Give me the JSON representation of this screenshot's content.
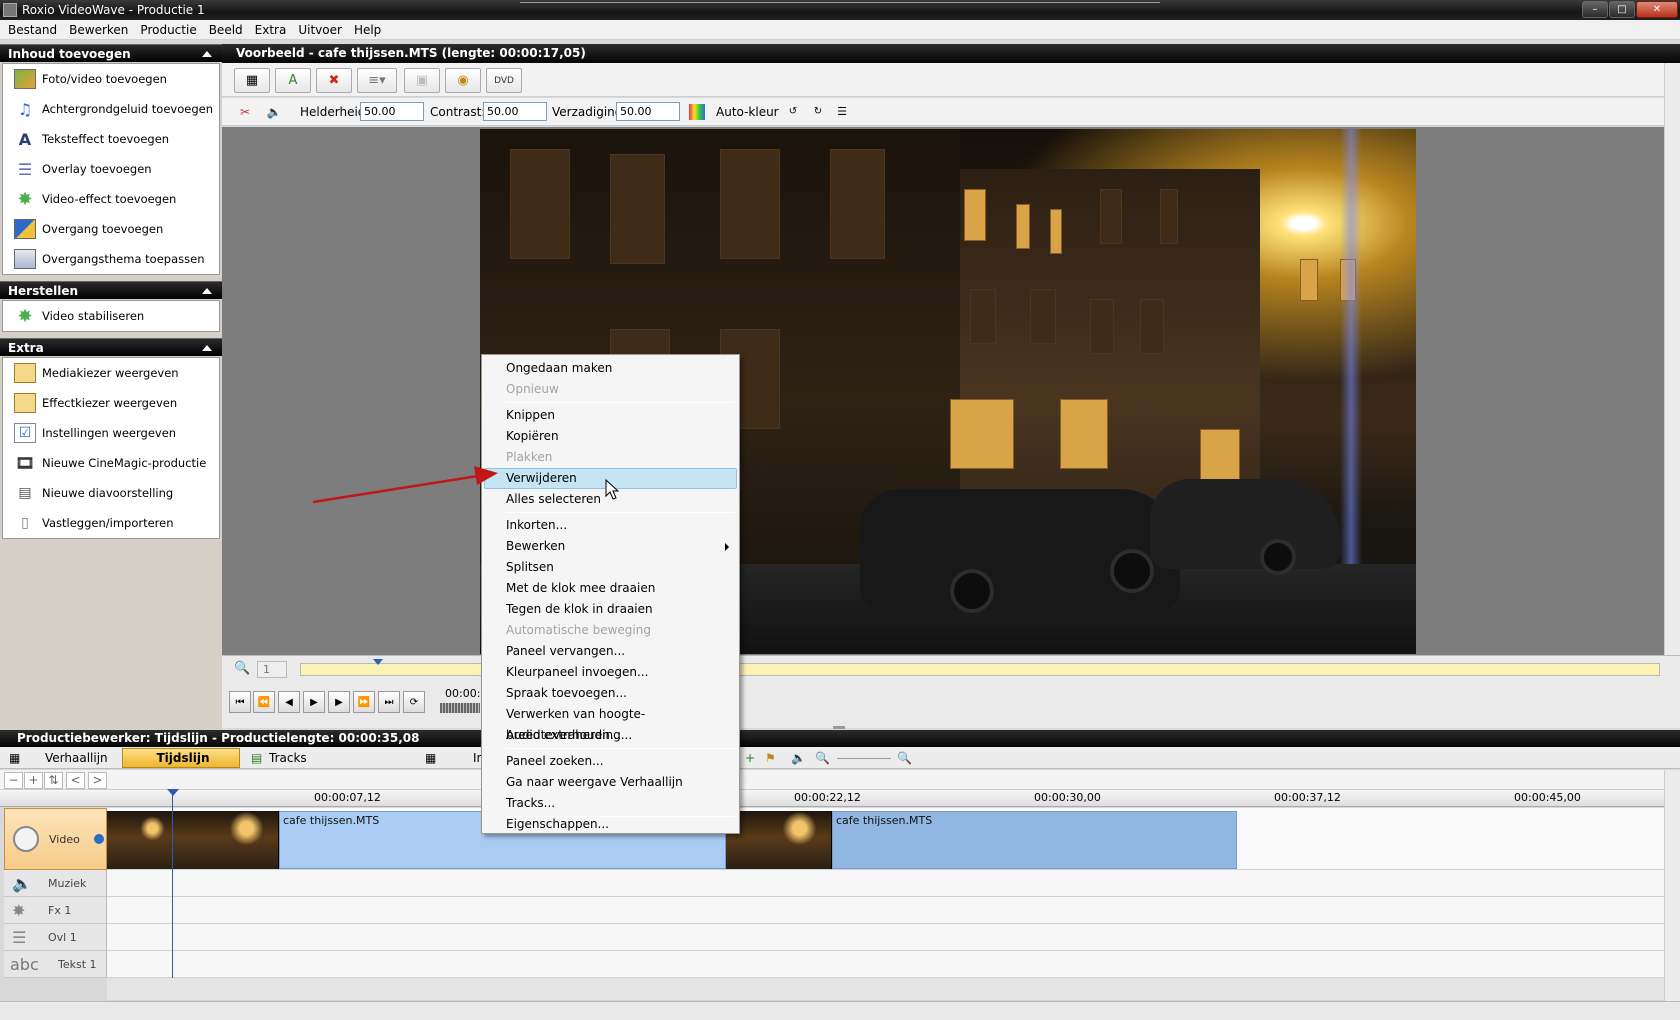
{
  "window": {
    "title": "Roxio VideoWave - Productie 1"
  },
  "menu": [
    "Bestand",
    "Bewerken",
    "Productie",
    "Beeld",
    "Extra",
    "Uitvoer",
    "Help"
  ],
  "sidebar": {
    "sections": [
      {
        "title": "Inhoud toevoegen",
        "items": [
          "Foto/video toevoegen",
          "Achtergrondgeluid toevoegen",
          "Teksteffect toevoegen",
          "Overlay toevoegen",
          "Video-effect toevoegen",
          "Overgang toevoegen",
          "Overgangsthema toepassen"
        ]
      },
      {
        "title": "Herstellen",
        "items": [
          "Video stabiliseren"
        ]
      },
      {
        "title": "Extra",
        "items": [
          "Mediakiezer weergeven",
          "Effectkiezer weergeven",
          "Instellingen weergeven",
          "Nieuwe CineMagic-productie",
          "Nieuwe diavoorstelling",
          "Vastleggen/importeren"
        ]
      }
    ]
  },
  "preview": {
    "title": "Voorbeeld - cafe thijssen.MTS (lengte: 00:00:17,05)",
    "adjust": {
      "brightness_label": "Helderheid:",
      "brightness": "50.00",
      "contrast_label": "Contrast:",
      "contrast": "50.00",
      "saturation_label": "Verzadiging:",
      "saturation": "50.00",
      "autocolor_label": "Auto-kleur"
    },
    "frame_number": "1",
    "timecode": "00:00:"
  },
  "production": {
    "title": "Productiebewerker: Tijdslijn - Productielengte: 00:00:35,08",
    "tabs": {
      "storyline": "Verhaallijn",
      "timeline": "Tijdslijn",
      "tracks": "Tracks weergeven/verbergen",
      "partial": "In"
    },
    "ruler_ticks": [
      "00:00:07,12",
      "00:00:22,12",
      "00:00:30,00",
      "00:00:37,12",
      "00:00:45,00"
    ],
    "tracks": {
      "video": "Video",
      "music": "Muziek",
      "fx": "Fx 1",
      "overlay": "Ovl 1",
      "text": "Tekst 1",
      "text_icon": "abc"
    },
    "clips": [
      "cafe thijssen.MTS",
      "cafe thijssen.MTS"
    ]
  },
  "context_menu": {
    "items": [
      {
        "label": "Ongedaan maken",
        "disabled": false
      },
      {
        "label": "Opnieuw",
        "disabled": true
      },
      {
        "label": "Knippen",
        "disabled": false
      },
      {
        "label": "Kopiëren",
        "disabled": false
      },
      {
        "label": "Plakken",
        "disabled": true
      },
      {
        "label": "Verwijderen",
        "disabled": false
      },
      {
        "label": "Alles selecteren",
        "disabled": false
      },
      {
        "label": "Inkorten...",
        "disabled": false
      },
      {
        "label": "Bewerken",
        "disabled": false
      },
      {
        "label": "Splitsen",
        "disabled": false
      },
      {
        "label": "Met de klok mee draaien",
        "disabled": false
      },
      {
        "label": "Tegen de klok in draaien",
        "disabled": false
      },
      {
        "label": "Automatische beweging",
        "disabled": true
      },
      {
        "label": "Paneel vervangen...",
        "disabled": false
      },
      {
        "label": "Kleurpaneel invoegen...",
        "disabled": false
      },
      {
        "label": "Spraak toevoegen...",
        "disabled": false
      },
      {
        "label": "Verwerken van hoogte-breedteverhouding...",
        "disabled": false
      },
      {
        "label": "Audio extraheren...",
        "disabled": false
      },
      {
        "label": "Paneel zoeken...",
        "disabled": false
      },
      {
        "label": "Ga naar weergave Verhaallijn",
        "disabled": false
      },
      {
        "label": "Tracks...",
        "disabled": false
      },
      {
        "label": "Eigenschappen...",
        "disabled": false
      }
    ],
    "highlighted": "Verwijderen"
  }
}
